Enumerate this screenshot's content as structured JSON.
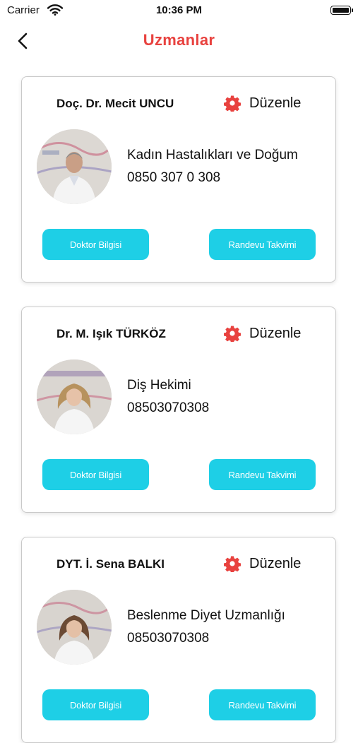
{
  "status_bar": {
    "carrier": "Carrier",
    "time": "10:36 PM"
  },
  "nav": {
    "title": "Uzmanlar"
  },
  "colors": {
    "accent_title": "#e8423f",
    "button": "#1ecfe6",
    "gear": "#e8423f"
  },
  "experts": [
    {
      "name": "Doç. Dr. Mecit UNCU",
      "edit_label": "Düzenle",
      "specialty": "Kadın Hastalıkları ve Doğum",
      "phone": "0850 307 0 308",
      "info_button": "Doktor Bilgisi",
      "calendar_button": "Randevu Takvimi",
      "avatar": "doctor-photo-male"
    },
    {
      "name": "Dr. M. Işık TÜRKÖZ",
      "edit_label": "Düzenle",
      "specialty": "Diş Hekimi",
      "phone": "08503070308",
      "info_button": "Doktor Bilgisi",
      "calendar_button": "Randevu Takvimi",
      "avatar": "doctor-photo-female"
    },
    {
      "name": "DYT. İ. Sena BALKI",
      "edit_label": "Düzenle",
      "specialty": "Beslenme Diyet Uzmanlığı",
      "phone": "08503070308",
      "info_button": "Doktor Bilgisi",
      "calendar_button": "Randevu Takvimi",
      "avatar": "doctor-photo-female"
    }
  ]
}
